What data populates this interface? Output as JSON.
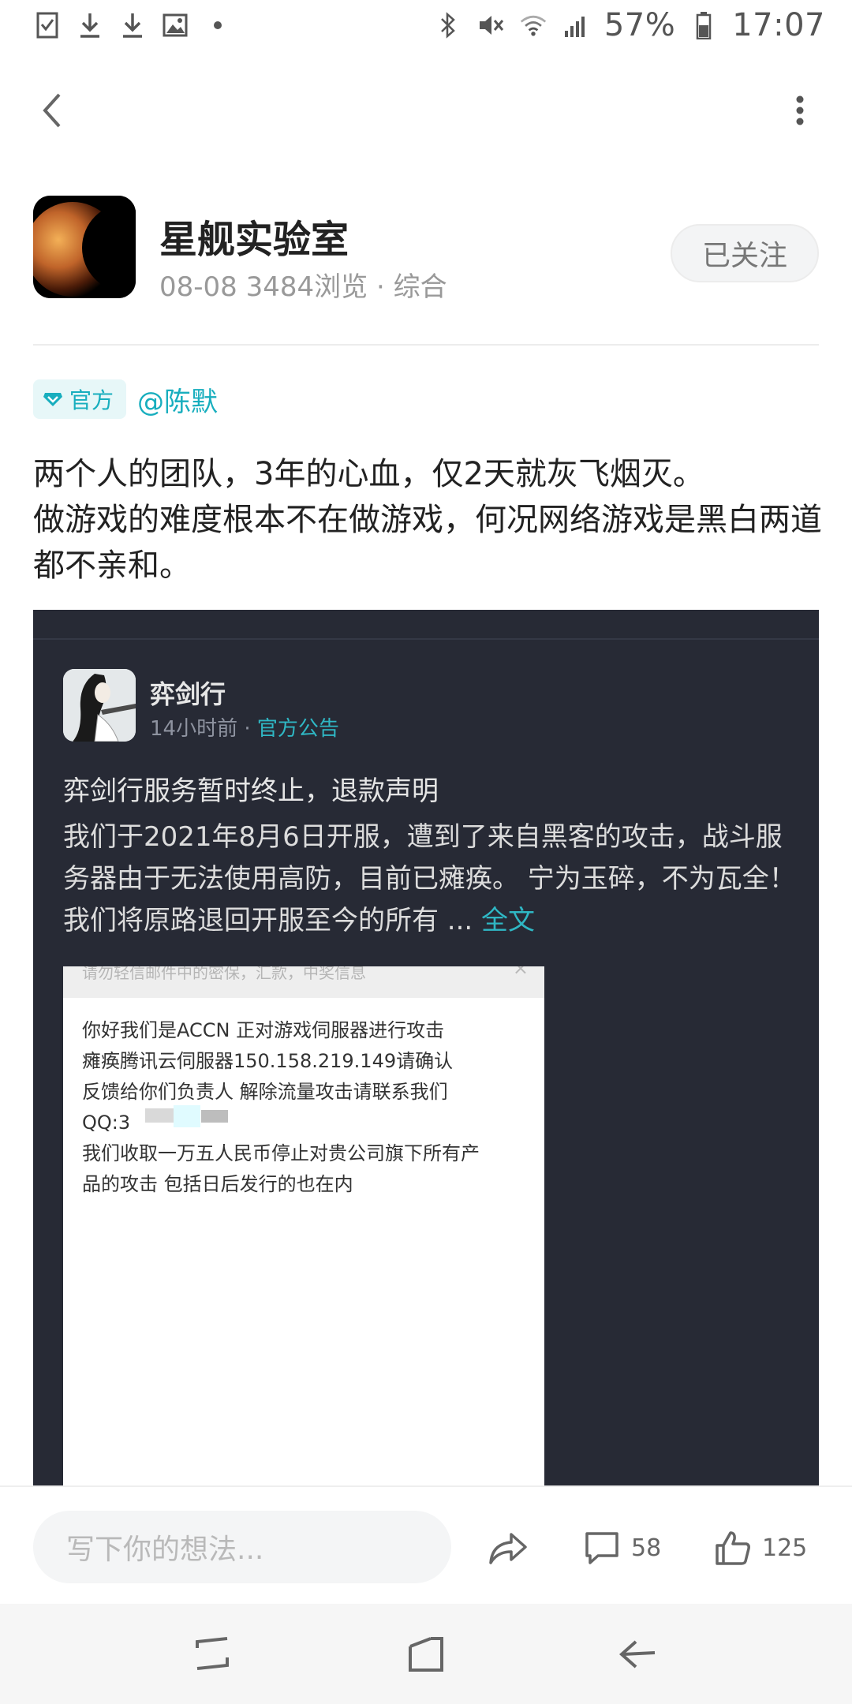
{
  "status_bar": {
    "left_icons": [
      "notes-icon",
      "download-icon",
      "download-icon",
      "image-icon",
      "dot-icon"
    ],
    "right_icons": [
      "bluetooth-icon",
      "mute-icon",
      "wifi-icon",
      "signal-icon",
      "battery-icon"
    ],
    "battery": "57%",
    "time": "17:07"
  },
  "app_bar": {
    "back_icon": "chevron-left-icon",
    "more_icon": "more-vertical-icon"
  },
  "author": {
    "name": "星舰实验室",
    "date": "08-08",
    "views": "3484浏览",
    "separator": "·",
    "category": "综合",
    "follow_label": "已关注"
  },
  "post": {
    "official_tag": "官方",
    "mention": "@陈默",
    "text_line1": "两个人的团队，3年的心血，仅2天就灰飞烟灭。",
    "text_line2": "做游戏的难度根本不在做游戏，何况网络游戏是黑白两道都不亲和。"
  },
  "embed": {
    "name": "弈剑行",
    "time": "14小时前",
    "separator": "·",
    "category": "官方公告",
    "title": "弈剑行服务暂时终止，退款声明",
    "body": "我们于2021年8月6日开服，遭到了来自黑客的攻击，战斗服务器由于无法使用高防，目前已瘫痪。 宁为玉碎，不为瓦全！ 我们将原路退回开服至今的所有 ...",
    "full_text_label": "全文",
    "screenshot": {
      "header": "请勿轻信邮件中的密保，汇款，中奖信息",
      "close": "×",
      "line1": "你好我们是ACCN 正对游戏伺服器进行攻击",
      "line2": "瘫痪腾讯云伺服器150.158.219.149请确认",
      "line3": "反馈给你们负责人 解除流量攻击请联系我们",
      "line4": "QQ:3",
      "line5": "我们收取一万五人民币停止对贵公司旗下所有产",
      "line6": "品的攻击 包括日后发行的也在内"
    }
  },
  "action_bar": {
    "comment_placeholder": "写下你的想法...",
    "comments": "58",
    "likes": "125"
  },
  "colors": {
    "accent": "#18aebe",
    "embed_bg": "#272a35"
  }
}
